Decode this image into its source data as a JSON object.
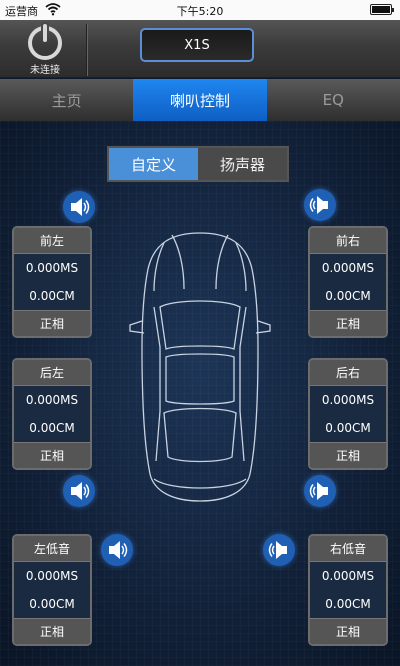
{
  "status_bar": {
    "carrier": "运营商",
    "time": "下午5:20"
  },
  "header": {
    "connection_status": "未连接",
    "device_name": "X1S"
  },
  "tabs": [
    {
      "label": "主页",
      "active": false
    },
    {
      "label": "喇叭控制",
      "active": true
    },
    {
      "label": "EQ",
      "active": false
    }
  ],
  "mode_selector": {
    "options": [
      "自定义",
      "扬声器"
    ],
    "selected": "自定义"
  },
  "channels": {
    "front_left": {
      "name": "前左",
      "delay": "0.000MS",
      "distance": "0.00CM",
      "phase": "正相"
    },
    "front_right": {
      "name": "前右",
      "delay": "0.000MS",
      "distance": "0.00CM",
      "phase": "正相"
    },
    "rear_left": {
      "name": "后左",
      "delay": "0.000MS",
      "distance": "0.00CM",
      "phase": "正相"
    },
    "rear_right": {
      "name": "后右",
      "delay": "0.000MS",
      "distance": "0.00CM",
      "phase": "正相"
    },
    "sub_left": {
      "name": "左低音",
      "delay": "0.000MS",
      "distance": "0.00CM",
      "phase": "正相"
    },
    "sub_right": {
      "name": "右低音",
      "delay": "0.000MS",
      "distance": "0.00CM",
      "phase": "正相"
    }
  },
  "colors": {
    "accent_blue": "#1f86f0",
    "segment_active": "#4a90d9",
    "speaker_button": "#1f5fb4",
    "background": "#12223a"
  },
  "icons": {
    "power": "power-icon",
    "speaker": "speaker-icon"
  }
}
